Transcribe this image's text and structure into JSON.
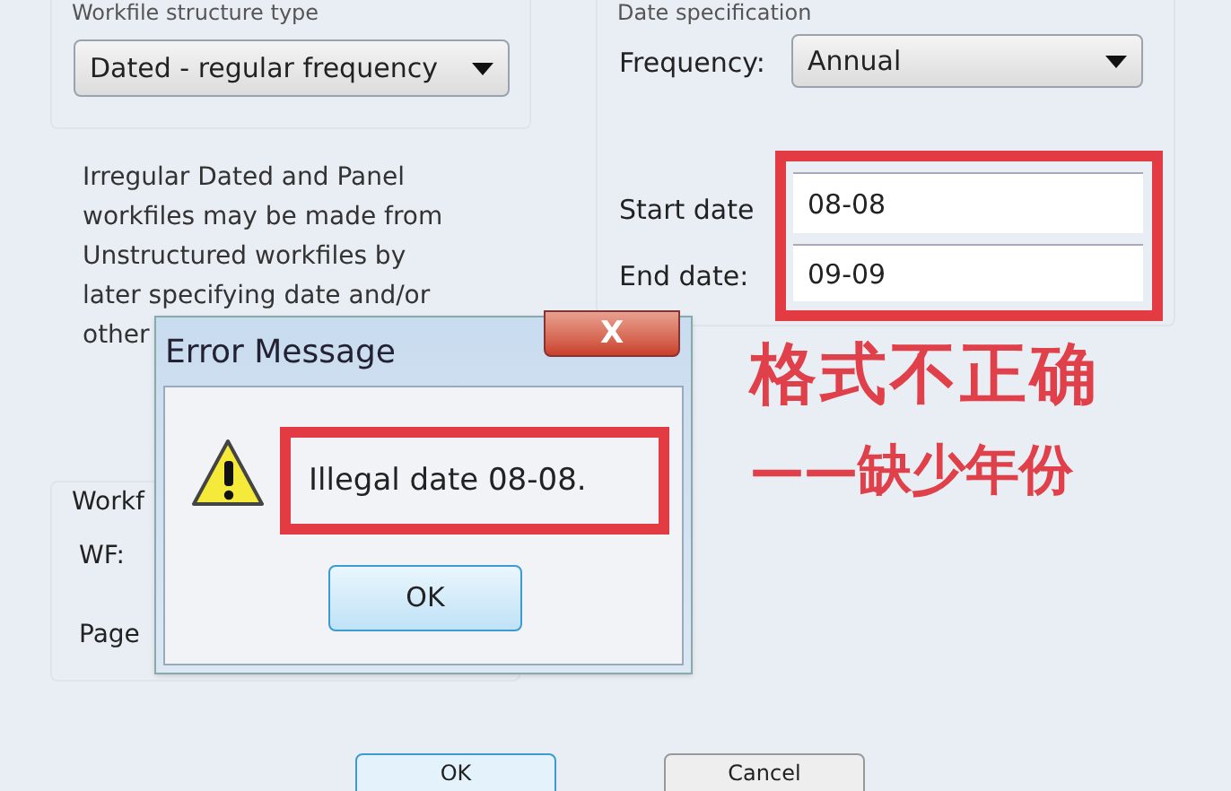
{
  "structure_group": {
    "label": "Workfile structure type",
    "dropdown": "Dated - regular frequency"
  },
  "note_lines": [
    "Irregular Dated and Panel",
    "workfiles may be made from",
    "Unstructured workfiles by",
    "later specifying date and/or",
    "other"
  ],
  "names_group": {
    "label": "Workf",
    "fields": [
      "WF:",
      "Page"
    ]
  },
  "date_group": {
    "label": "Date specification",
    "frequency_label": "Frequency:",
    "frequency": "Annual",
    "start_label": "Start date",
    "start": "08-08",
    "end_label": "End date:",
    "end": "09-09"
  },
  "annotation": [
    "格式不正确",
    "——缺少年份"
  ],
  "dialog": {
    "title": "Error Message",
    "close": "X",
    "message": "Illegal date 08-08.",
    "button": "OK"
  },
  "buttons": [
    "OK",
    "Cancel"
  ]
}
